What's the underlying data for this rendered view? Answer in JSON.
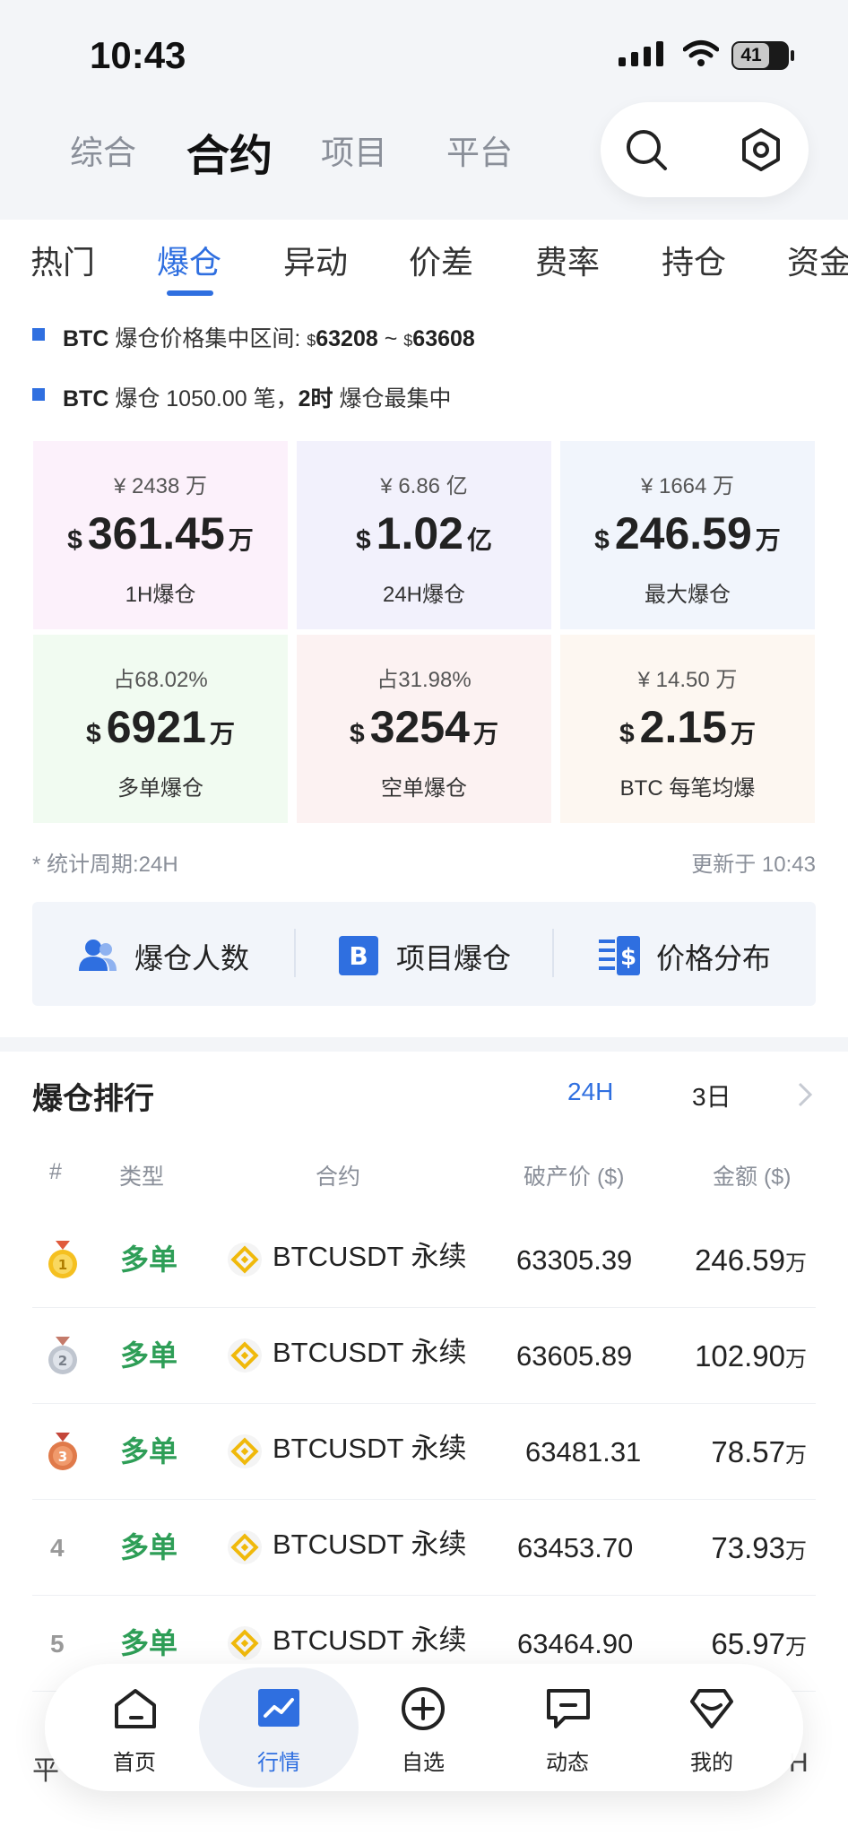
{
  "status": {
    "time": "10:43",
    "battery": "41"
  },
  "top_nav": {
    "items": [
      "综合",
      "合约",
      "项目",
      "平台"
    ],
    "active": 1
  },
  "sub_tabs": {
    "items": [
      "热门",
      "爆仓",
      "异动",
      "价差",
      "费率",
      "持仓",
      "资金"
    ],
    "active": 1
  },
  "summary": {
    "line1_pre": "BTC",
    "line1_mid": " 爆仓价格集中区间: ",
    "line1_low_cur": "$",
    "line1_low": "63208",
    "line1_sep": " ~ ",
    "line1_high_cur": "$",
    "line1_high": "63608",
    "line2_pre": "BTC",
    "line2_mid": " 爆仓 1050.00 笔，",
    "line2_hours": "2时",
    "line2_post": " 爆仓最集中"
  },
  "cards": [
    {
      "sub": "¥ 2438 万",
      "cur": "$",
      "value": "361.45",
      "unit": "万",
      "label": "1H爆仓",
      "bg": "#fcf1fb"
    },
    {
      "sub": "¥ 6.86 亿",
      "cur": "$",
      "value": "1.02",
      "unit": "亿",
      "label": "24H爆仓",
      "bg": "#f2f1fc"
    },
    {
      "sub": "¥ 1664 万",
      "cur": "$",
      "value": "246.59",
      "unit": "万",
      "label": "最大爆仓",
      "bg": "#f1f5fc"
    },
    {
      "sub": "占68.02%",
      "cur": "$",
      "value": "6921",
      "unit": "万",
      "label": "多单爆仓",
      "bg": "#f1fbf1"
    },
    {
      "sub": "占31.98%",
      "cur": "$",
      "value": "3254",
      "unit": "万",
      "label": "空单爆仓",
      "bg": "#fcf2f2"
    },
    {
      "sub": "¥ 14.50 万",
      "cur": "$",
      "value": "2.15",
      "unit": "万",
      "label": "BTC 每笔均爆",
      "bg": "#fdf7f1"
    }
  ],
  "stats_footer": {
    "period": "* 统计周期:24H",
    "updated": "更新于 10:43"
  },
  "toolbar": {
    "people": "爆仓人数",
    "project": "项目爆仓",
    "price_dist": "价格分布"
  },
  "ranking": {
    "title": "爆仓排行",
    "tabs": [
      "24H",
      "3日"
    ],
    "active_tab": 0,
    "headers": {
      "num": "#",
      "type": "类型",
      "contract": "合约",
      "price": "破产价 ($)",
      "amount": "金额 ($)"
    },
    "rows": [
      {
        "rank": "1",
        "type": "多单",
        "symbol": "BTCUSDT 永续",
        "price": "63305.39",
        "amount": "246.59",
        "unit": "万"
      },
      {
        "rank": "2",
        "type": "多单",
        "symbol": "BTCUSDT 永续",
        "price": "63605.89",
        "amount": "102.90",
        "unit": "万"
      },
      {
        "rank": "3",
        "type": "多单",
        "symbol": "BTCUSDT 永续",
        "price": "63481.31",
        "amount": "78.57",
        "unit": "万"
      },
      {
        "rank": "4",
        "type": "多单",
        "symbol": "BTCUSDT 永续",
        "price": "63453.70",
        "amount": "73.93",
        "unit": "万"
      },
      {
        "rank": "5",
        "type": "多单",
        "symbol": "BTCUSDT 永续",
        "price": "63464.90",
        "amount": "65.97",
        "unit": "万"
      }
    ]
  },
  "peek_section": {
    "title_partial": "平",
    "right_partial": "H"
  },
  "tab_bar": {
    "items": [
      "首页",
      "行情",
      "自选",
      "动态",
      "我的"
    ],
    "active": 1
  },
  "colors": {
    "accent": "#2f6fe0",
    "long_green": "#2e9e57",
    "coin_yellow": "#f0b90b",
    "gold": "#f5c020",
    "silver": "#bfc5cf",
    "bronze": "#e07a4a"
  }
}
